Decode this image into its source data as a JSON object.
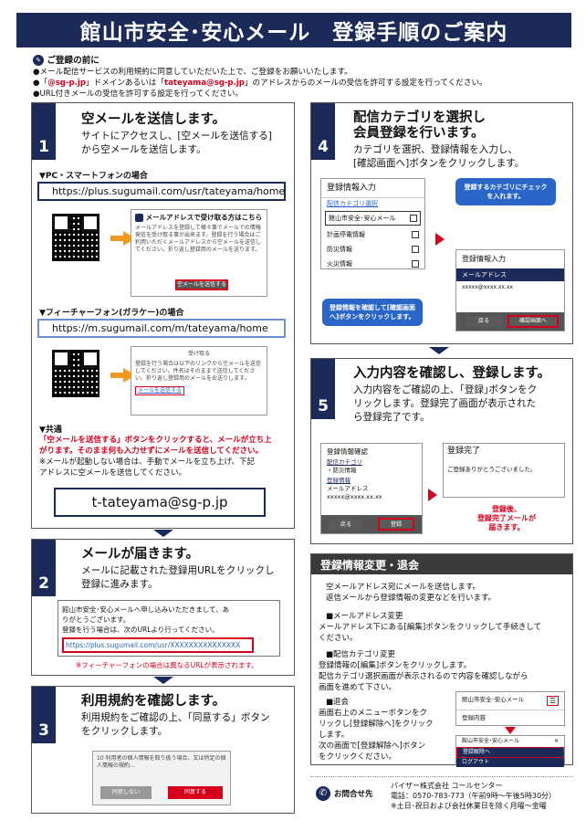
{
  "header": {
    "title": "館山市安全･安心メール　登録手順のご案内"
  },
  "pre": {
    "title": "ご登録の前に",
    "line1": "●メール配信サービスの利用規約に同意していただいた上で、ご登録をお願いいたします。",
    "line2_a": "●「",
    "line2_b": "@sg-p.jp",
    "line2_c": "」ドメインあるいは「",
    "line2_d": "tateyama@sg-p.jp",
    "line2_e": "」のアドレスからのメールの受信を許可する設定を行ってください。",
    "line3": "●URL付きメールの受信を許可する設定を行ってください。"
  },
  "step1": {
    "num": "1",
    "title": "空メールを送信します。",
    "desc1": "サイトにアクセスし、[空メールを送信する]",
    "desc2": "から空メールを送信します。",
    "pc_label": "▼PC・スマートフォンの場合",
    "pc_url": "https://plus.sugumail.com/usr/tateyama/home",
    "pc_mock_title": "メールアドレスで受け取る方はこちら",
    "pc_mock_body": "メールアドレスを登録して様々事でメールでの情報発信を受け取る事が出来ます。登録を行う場合はご利用いただくメールアドレスから空メールを送信してください。折り返し登録用のメールを送ります。",
    "pc_mock_btn": "空メールを送信する",
    "fp_label": "▼フィーチャーフォン(ガラケー)の場合",
    "fp_url": "https://m.sugumail.com/m/tateyama/home",
    "fp_mock_title": "受け取る",
    "fp_mock_body": "登録を行う場合は以下のリンクから空メールを送信してください。件名はそのままで送信してください。折り返し登録用のメールをお送りします。",
    "fp_mock_link": "メールを送信する",
    "common_label": "▼共通",
    "common_red1": "「空メールを送信する」ボタンをクリックすると、メールが立ち上",
    "common_red2": "がります。そのまま何も入力せずにメールを送信してください。",
    "common_3": "※メールが起動しない場合は、手動でメールを立ち上げ、下記",
    "common_4": "アドレスに空メールを送信してください。",
    "email": "t-tateyama@sg-p.jp"
  },
  "step2": {
    "num": "2",
    "title": "メールが届きます。",
    "desc1": "メールに記載された登録用URLをクリックし",
    "desc2": "登録に進みます。",
    "mail1": "館山市安全･安心メールへ申し込みいただきまして、あ",
    "mail2": "りがとうございます。",
    "mail3": "登録を行う場合は、次のURLより行ってください。",
    "mail_url": "https://plus.sugumail.com/usr/XXXXXXXXXXXXXXX",
    "note": "※フィーチャーフォンの場合は異なるURLが表示されます。"
  },
  "step3": {
    "num": "3",
    "title": "利用規約を確認します。",
    "desc1": "利用規約をご確認の上、「同意する」ボタン",
    "desc2": "をクリックします。",
    "mock_text": "10 利用者の個人情報を取り扱う場合、又は特定の個人情報の規約…",
    "btn_no": "同意しない",
    "btn_yes": "同意する"
  },
  "step4": {
    "num": "4",
    "title1": "配信カテゴリを選択し",
    "title2": "会員登録を行います。",
    "desc1": "カテゴリを選択、登録情報を入力し、",
    "desc2": "[確認画面へ]ボタンをクリックします。",
    "form_title": "登録情報入力",
    "cat_head": "配信カテゴリ選択",
    "cats": [
      "館山市安全･安心メール",
      "計画停電情報",
      "防災情報",
      "火災情報"
    ],
    "bubble1": "登録するカテゴリにチェックを入れます。",
    "form2_title": "登録情報入力",
    "form2_field": "メールアドレス",
    "form2_value": "xxxxx@xxxx.xx.xx",
    "bubble2": "登録情報を確認して[確認画面へ]ボタンをクリックします。",
    "btn_back": "戻る",
    "btn_confirm": "確認画面へ"
  },
  "step5": {
    "num": "5",
    "title": "入力内容を確認し、登録します。",
    "desc1": "入力内容をご確認の上、｢登録｣ボタンをク",
    "desc2": "リックします。登録完了画面が表示された",
    "desc3": "ら登録完了です。",
    "confirm_title": "登録情報確認",
    "confirm_cat": "配信カテゴリ",
    "confirm_item": "・防災情報",
    "confirm_reg": "登録情報",
    "confirm_mail": "メールアドレス",
    "confirm_val": "xxxxx@xxxx.xx.xx",
    "btn_back": "戻る",
    "btn_reg": "登録",
    "done_title": "登録完了",
    "done_msg": "ご登録ありがとうございました。",
    "after1": "登録後、",
    "after2": "登録完了メールが",
    "after3": "届きます。"
  },
  "change": {
    "title": "登録情報変更・退会",
    "intro1": "空メールアドレス宛にメールを送信します。",
    "intro2": "返信メールから登録情報の変更などを行います。",
    "mail_head": "■メールアドレス変更",
    "mail_body1": "メールアドレス下にある[編集]ボタンをクリックして手続きして",
    "mail_body2": "ください。",
    "cat_head": "■配信カテゴリ変更",
    "cat_body1": "登録情報の[編集]ボタンをクリックします。",
    "cat_body2": "配信カテゴリ選択画面が表示されるので内容を確認しながら",
    "cat_body3": "画面を進めて下さい。",
    "quit_head": "■退会",
    "quit_body1": "画面右上のメニューボタンをク",
    "quit_body2": "リックし[登録解除へ]をクリック",
    "quit_body3": "します。",
    "quit_body4": "次の画面で[登録解除へ]ボタン",
    "quit_body5": "をクリックください。",
    "menu_title": "館山市安全･安心メール",
    "menu_item": "登録内容",
    "menu2_title": "館山市安全･安心メール",
    "menu2_item1": "登録解除へ",
    "menu2_item2": "ログアウト"
  },
  "contact": {
    "label": "お問合せ先",
    "company": "パイザー株式会社 コールセンター",
    "tel": "電話：0570-783-773（午前9時～午後5時30分）",
    "note": "※土日･祝日および会社休業日を除く月曜～金曜"
  },
  "colors": {
    "navy": "#1b2a59",
    "red": "#d6001c",
    "orange": "#f39a1e",
    "blue": "#2a66c8"
  }
}
